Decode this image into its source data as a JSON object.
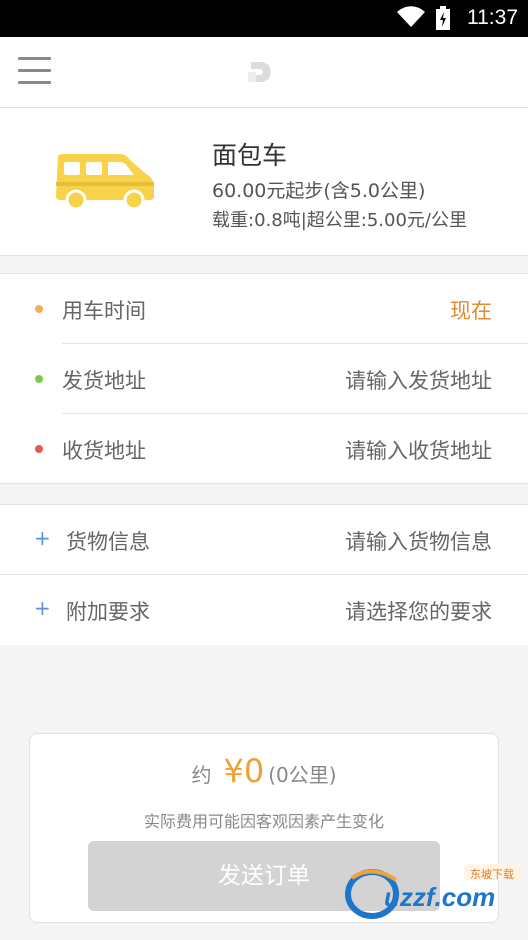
{
  "status_bar": {
    "time": "11:37"
  },
  "vehicle": {
    "name": "面包车",
    "price": "60.00元起步(含5.0公里)",
    "spec": "载重:0.8吨|超公里:5.00元/公里",
    "van_color": "#f7d24a"
  },
  "order_rows": [
    {
      "label": "用车时间",
      "value": "现在",
      "dot_color": "#efb155"
    },
    {
      "label": "发货地址",
      "value": "请输入发货地址",
      "dot_color": "#7dc94a"
    },
    {
      "label": "收货地址",
      "value": "请输入收货地址",
      "dot_color": "#e05a50"
    }
  ],
  "extra_rows": [
    {
      "label": "货物信息",
      "value": "请输入货物信息"
    },
    {
      "label": "附加要求",
      "value": "请选择您的要求"
    }
  ],
  "estimate": {
    "prefix": "约",
    "price": "¥0",
    "distance": "(0公里)",
    "note": "实际费用可能因客观因素产生变化"
  },
  "submit_label": "发送订单",
  "watermark": {
    "text": "uzzf.com",
    "sub": "东坡下载"
  },
  "colors": {
    "accent": "#e38b2e",
    "price": "#f0a134",
    "plus": "#5b8fd6"
  }
}
